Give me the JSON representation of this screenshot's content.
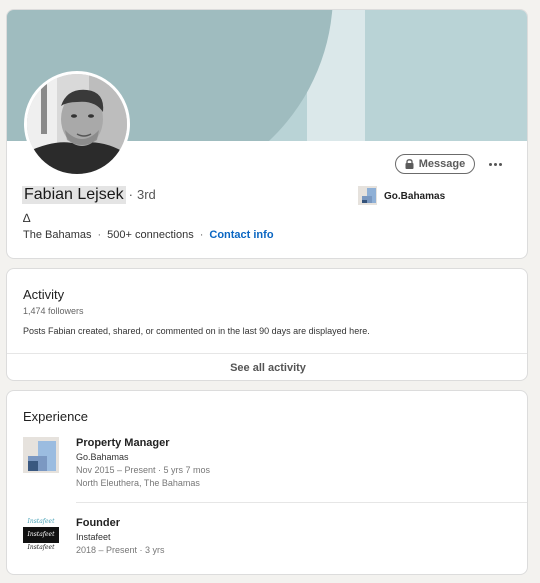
{
  "profile": {
    "name": "Fabian Lejsek",
    "degree_separator": "·",
    "degree": "3rd",
    "headline": "∆",
    "location": "The Bahamas",
    "meta_separator": "·",
    "connections": "500+ connections",
    "contact_label": "Contact info",
    "message_button": "Message",
    "current_company": "Go.Bahamas",
    "colors": {
      "banner_base": "#b9d3d6",
      "banner_circle": "#9fbcbf",
      "banner_light": "#dbe8ea",
      "link": "#0a66c2"
    }
  },
  "activity": {
    "title": "Activity",
    "followers": "1,474 followers",
    "description": "Posts Fabian created, shared, or commented on in the last 90 days are displayed here.",
    "see_all": "See all activity"
  },
  "experience": {
    "title": "Experience",
    "items": [
      {
        "title": "Property Manager",
        "company": "Go.Bahamas",
        "dates": "Nov 2015 – Present · 5 yrs 7 mos",
        "location": "North Eleuthera, The Bahamas",
        "logo_icon": "go-bahamas-logo"
      },
      {
        "title": "Founder",
        "company": "Instafeet",
        "dates": "2018 – Present · 3 yrs",
        "location": "",
        "logo_icon": "instafeet-logo",
        "logo_text": "Instafeet"
      }
    ]
  }
}
